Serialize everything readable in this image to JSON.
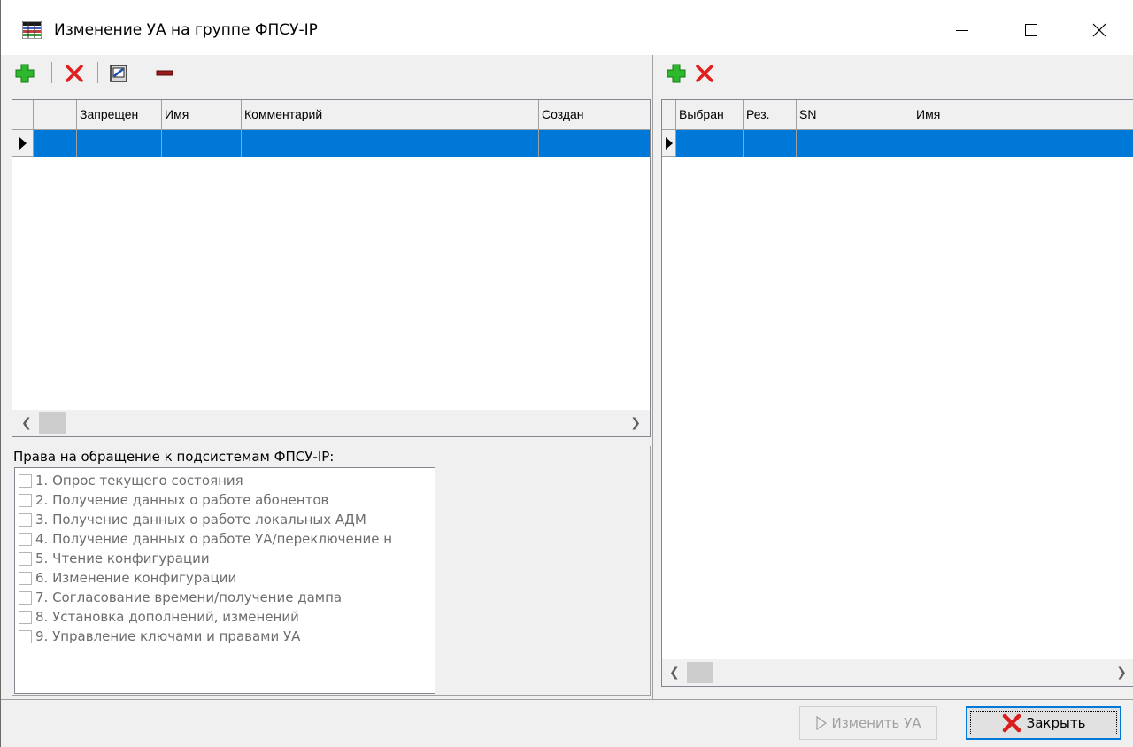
{
  "window": {
    "title": "Изменение УА на группе ФПСУ-IP",
    "icon": "table-app-icon"
  },
  "left_toolbar": {
    "buttons": [
      {
        "icon": "add-icon",
        "color": "#1ea01e"
      },
      {
        "icon": "delete-icon",
        "color": "#e02020"
      },
      {
        "icon": "edit-icon"
      },
      {
        "icon": "remove-icon",
        "color": "#8b1a1a"
      }
    ]
  },
  "right_toolbar": {
    "buttons": [
      {
        "icon": "add-icon",
        "color": "#1ea01e"
      },
      {
        "icon": "delete-icon",
        "color": "#e02020"
      }
    ]
  },
  "left_grid": {
    "columns": [
      "",
      "Запрещен",
      "Имя",
      "Комментарий",
      "Создан"
    ],
    "rows": [
      [
        "",
        "",
        "",
        "",
        ""
      ]
    ]
  },
  "right_grid": {
    "columns": [
      "Выбран",
      "Рез.",
      "SN",
      "Имя"
    ],
    "rows": [
      [
        "",
        "",
        "",
        ""
      ]
    ]
  },
  "rights": {
    "label": "Права на обращение к подсистемам ФПСУ-IP:",
    "items": [
      {
        "label": "1. Опрос текущего состояния",
        "checked": false
      },
      {
        "label": "2. Получение данных о работе абонентов",
        "checked": false
      },
      {
        "label": "3. Получение данных о работе локальных АДМ",
        "checked": false
      },
      {
        "label": "4. Получение данных о работе УА/переключение н",
        "checked": false
      },
      {
        "label": "5. Чтение конфигурации",
        "checked": false
      },
      {
        "label": "6. Изменение конфигурации",
        "checked": false
      },
      {
        "label": "7. Согласование времени/получение дампа",
        "checked": false
      },
      {
        "label": "8. Установка дополнений, изменений",
        "checked": false
      },
      {
        "label": "9. Управление ключами и правами УА",
        "checked": false
      }
    ]
  },
  "buttons": {
    "change_label": "Изменить УА",
    "change_enabled": false,
    "close_label": "Закрыть"
  },
  "colors": {
    "selection": "#0078d7",
    "accent_green": "#1ea01e",
    "accent_red": "#e02020"
  }
}
